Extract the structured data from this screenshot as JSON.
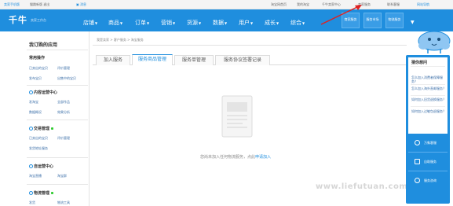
{
  "topbar": {
    "left": [
      "卖家手机版",
      "猫跳新版 退出"
    ],
    "home": "消息",
    "right": [
      "淘宝网首页",
      "我的淘宝",
      "千牛卖家中心",
      "卖家服务",
      "联系客服",
      "网站导航"
    ]
  },
  "header": {
    "logo": "千牛",
    "logo_sub": "卖家工作台",
    "nav": [
      "店铺",
      "商品",
      "订单",
      "营销",
      "货源",
      "数据",
      "用户",
      "成长",
      "综合"
    ],
    "plugins": [
      "商家服务",
      "服务市场",
      "物流服务"
    ]
  },
  "sidebar": {
    "title": "我订购的应用",
    "common": {
      "title": "常用操作",
      "links": [
        "已卖出的宝贝",
        "评价管理",
        "发布宝贝",
        "出售中的宝贝"
      ]
    },
    "groups": [
      {
        "title": "内容运营中心",
        "links": [
          "发淘宝",
          "全部作品",
          "数据概况",
          "效果分析"
        ]
      },
      {
        "title": "交易管理",
        "links": [
          "已卖出的宝贝",
          "评价管理",
          "发货地址服务"
        ]
      },
      {
        "title": "自运营中心",
        "links": [
          "淘宝直播",
          "淘宝群"
        ]
      },
      {
        "title": "物流管理",
        "links": [
          "发货",
          "物流工具"
        ]
      }
    ]
  },
  "content": {
    "breadcrumb": "我是卖家 > 客户服务 > 淘宝服务",
    "tabs": [
      "加入服务",
      "服务商品管理",
      "服务单管理",
      "服务协议签署记录"
    ],
    "empty_text": "您尚未加入任何物流服务，点此",
    "empty_link": "申请加入"
  },
  "help": {
    "title": "猜你想问",
    "questions": [
      "怎么加入消费者保障服务？",
      "怎么加入海外直邮服务？",
      "如何加入旧货退换服务？",
      "如何加入过敏包退服务？"
    ],
    "buttons": [
      "万象客服",
      "自助服务",
      "服务咨询"
    ]
  },
  "watermark": "www.liefutuan.com",
  "colors": {
    "brand": "#1f8ede",
    "annotation": "#e02020"
  }
}
